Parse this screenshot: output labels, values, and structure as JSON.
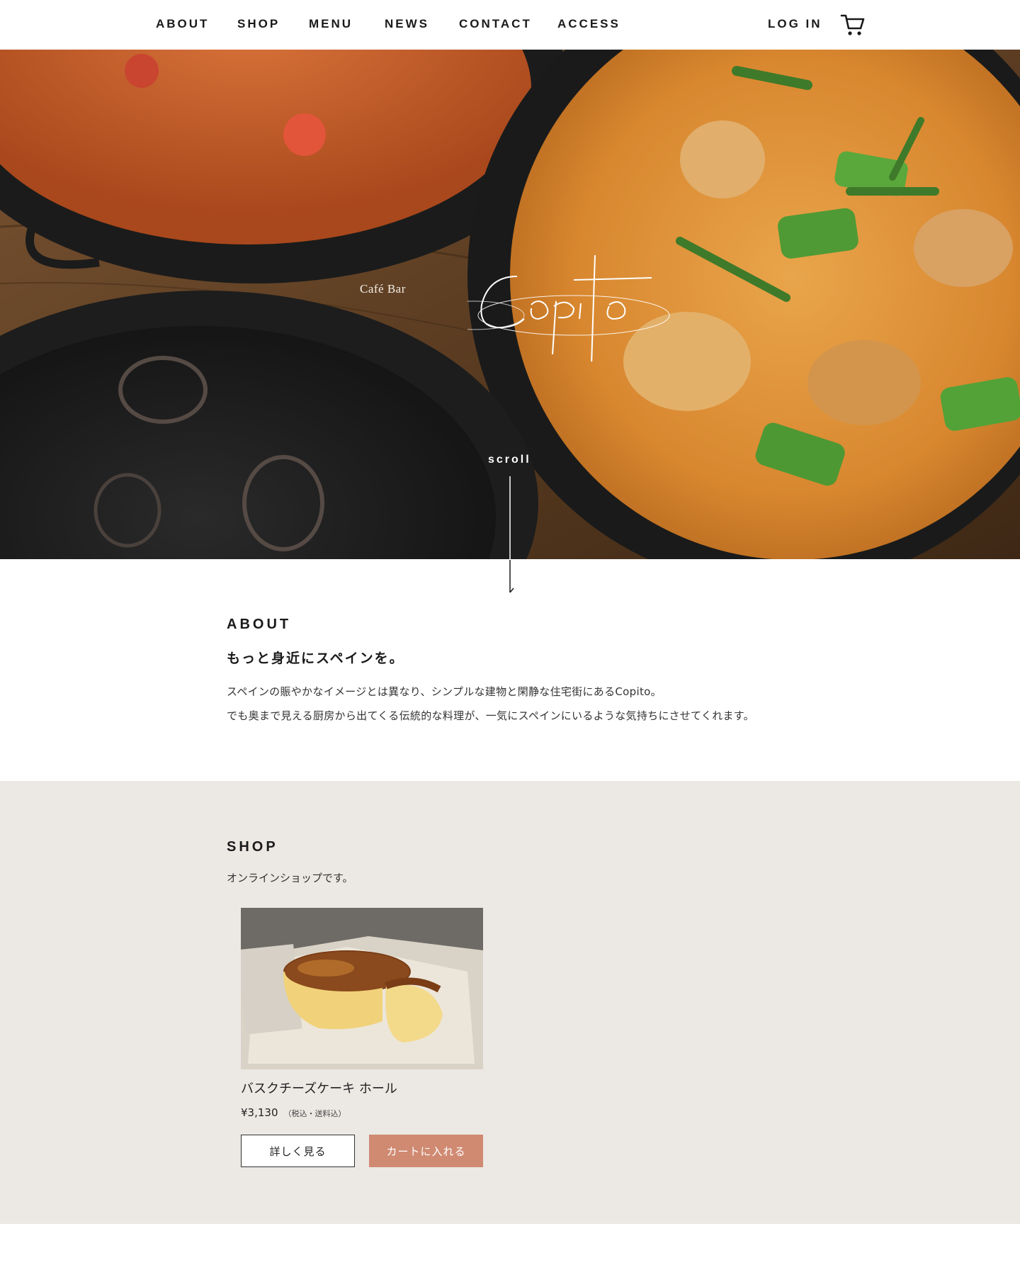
{
  "nav": {
    "items": [
      {
        "label": "ABOUT"
      },
      {
        "label": "SHOP"
      },
      {
        "label": "MENU"
      },
      {
        "label": "NEWS"
      },
      {
        "label": "CONTACT"
      },
      {
        "label": "ACCESS"
      }
    ],
    "login_label": "LOG IN",
    "cart_icon": "cart-icon"
  },
  "hero": {
    "logo_prefix": "Café Bar",
    "logo_name": "Copito",
    "scroll_label": "scroll"
  },
  "about": {
    "title": "ABOUT",
    "heading": "もっと身近にスペインを。",
    "lines": [
      "スペインの賑やかなイメージとは異なり、シンプルな建物と閑静な住宅街にあるCopito。",
      "でも奥まで見える厨房から出てくる伝統的な料理が、一気にスペインにいるような気持ちにさせてくれます。"
    ]
  },
  "shop": {
    "title": "SHOP",
    "subtitle": "オンラインショップです。",
    "product": {
      "name": "バスクチーズケーキ ホール",
      "price": "¥3,130",
      "price_note": "（税込・送料込）",
      "detail_button": "詳しく見る",
      "cart_button": "カートに入れる"
    }
  },
  "colors": {
    "accent": "#d08a72",
    "shop_background": "#ece8e4",
    "text": "#1a1a1a"
  }
}
